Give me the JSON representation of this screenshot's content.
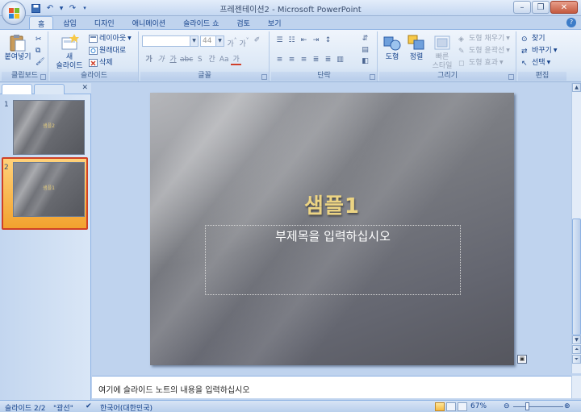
{
  "window": {
    "title": "프레젠테이션2 - Microsoft PowerPoint"
  },
  "ribbon_tabs": [
    {
      "label": "홈"
    },
    {
      "label": "삽입"
    },
    {
      "label": "디자인"
    },
    {
      "label": "애니메이션"
    },
    {
      "label": "슬라이드 쇼"
    },
    {
      "label": "검토"
    },
    {
      "label": "보기"
    }
  ],
  "clipboard": {
    "paste_label": "붙여넣기",
    "group_label": "클립보드"
  },
  "slides_group": {
    "new_slide_line1": "새",
    "new_slide_line2": "슬라이드",
    "layout_label": "레이아웃",
    "reset_label": "원래대로",
    "delete_label": "삭제",
    "group_label": "슬라이드"
  },
  "font_group": {
    "font_size": "44",
    "group_label": "글꼴"
  },
  "paragraph_group": {
    "group_label": "단락"
  },
  "drawing_group": {
    "shapes_label": "도형",
    "arrange_label": "정렬",
    "quick_styles_line1": "빠른",
    "quick_styles_line2": "스타일",
    "fill_label": "도형 채우기",
    "outline_label": "도형 윤곽선",
    "effects_label": "도형 효과",
    "group_label": "그리기"
  },
  "editing_group": {
    "find_label": "찾기",
    "replace_label": "바꾸기",
    "select_label": "선택",
    "group_label": "편집"
  },
  "thumbnails": [
    {
      "number": "1",
      "title": "샘플2"
    },
    {
      "number": "2",
      "title": "샘플1"
    }
  ],
  "slide": {
    "title": "샘플1",
    "subtitle_placeholder": "부제목을 입력하십시오"
  },
  "notes": {
    "placeholder": "여기에 슬라이드 노트의 내용을 입력하십시오"
  },
  "status": {
    "slide_counter": "슬라이드 2/2",
    "theme": "\"광선\"",
    "language": "한국어(대한민국)",
    "zoom": "67%"
  }
}
